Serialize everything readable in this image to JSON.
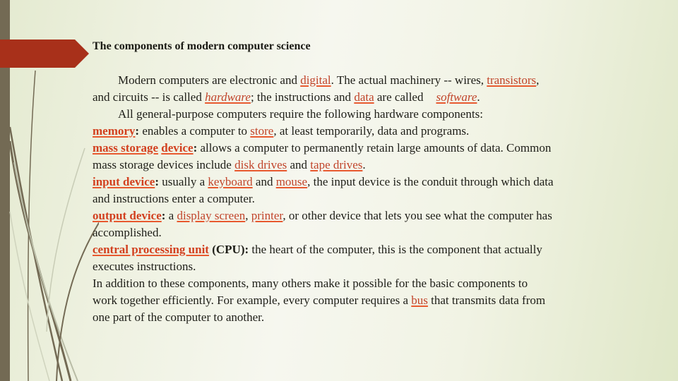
{
  "slide": {
    "title": "The components of modern computer science",
    "colors": {
      "accent_banner": "#a8301a",
      "left_bar": "#736a54",
      "link": "#c1452b",
      "term": "#d2401f"
    },
    "paragraph1": {
      "l1_a": "Modern computers are electronic and ",
      "l1_link1": "digital",
      "l1_b": ". The actual machinery -- wires, ",
      "l1_link2": "transistors",
      "l1_c": ",",
      "l2_a": "and circuits -- is called ",
      "l2_link1": "hardware",
      "l2_b": "; the instructions and ",
      "l2_link2": "data",
      "l2_c": " are called",
      "l2_link3": "software",
      "l2_d": "."
    },
    "paragraph2": {
      "l3": "All general-purpose computers require the following hardware components:"
    },
    "components": [
      {
        "term": "memory",
        "colon": ":",
        "text_a": " enables a computer to ",
        "link1": "store",
        "text_b": ", at least temporarily, data and programs."
      },
      {
        "term1": "mass storage",
        "term2": "device",
        "colon": ":",
        "text_a": " allows a computer to permanently retain large amounts of data. Common",
        "text_b": "mass storage devices include ",
        "link1": "disk drives",
        "text_c": " and ",
        "link2": "tape drives",
        "text_d": "."
      },
      {
        "term": "input device",
        "colon": ":",
        "text_a": " usually a ",
        "link1": "keyboard",
        "text_b": " and ",
        "link2": "mouse",
        "text_c": ", the input device is the conduit through which data",
        "text_d": "and instructions enter a computer."
      },
      {
        "term": "output device",
        "colon": ":",
        "text_a": " a ",
        "link1": "display screen",
        "text_b": ", ",
        "link2": "printer",
        "text_c": ", or other device that lets you see what the computer has",
        "text_d": "accomplished."
      },
      {
        "term": "central processing unit",
        "abbr": " (CPU):",
        "text_a": " the heart of the computer, this is the component that actually",
        "text_b": "executes instructions."
      }
    ],
    "closing": {
      "l1": "In addition to these components, many others make it possible for the basic components to",
      "l2_a": "work together efficiently. For example, every computer requires a ",
      "l2_link": "bus",
      "l2_b": " that transmits data from",
      "l3": "one part of the computer to another."
    },
    "icons": {
      "banner": "arrow-banner-icon",
      "grass": "grass-decoration-icon"
    }
  }
}
